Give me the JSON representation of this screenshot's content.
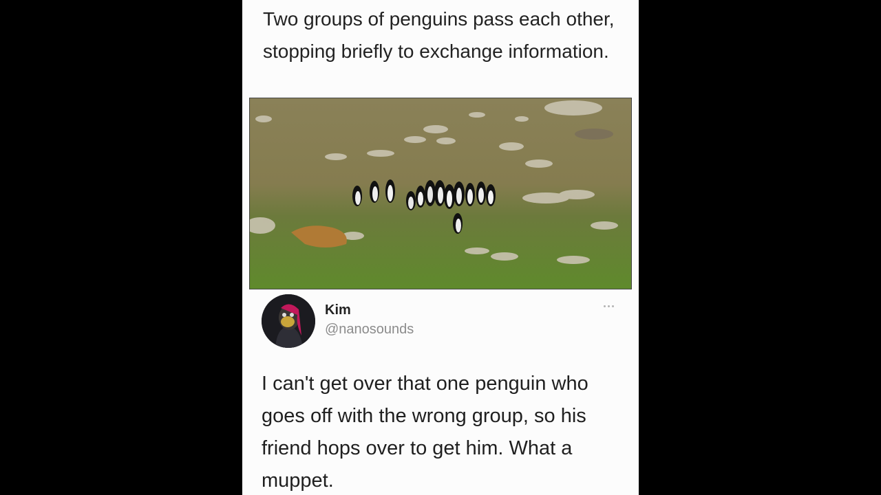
{
  "post": {
    "caption": "Two groups of penguins pass each other, stopping briefly to exchange information."
  },
  "tweet": {
    "name": "Kim",
    "handle": "@nanosounds",
    "text": "I can't get over that one penguin who goes off with the wrong group, so his friend hops over to get him. What a muppet.",
    "more_icon": "more-horizontal-icon"
  },
  "colors": {
    "background": "#000000",
    "card": "#fcfcfc",
    "text": "#222222",
    "handle": "#8b8b8b"
  }
}
